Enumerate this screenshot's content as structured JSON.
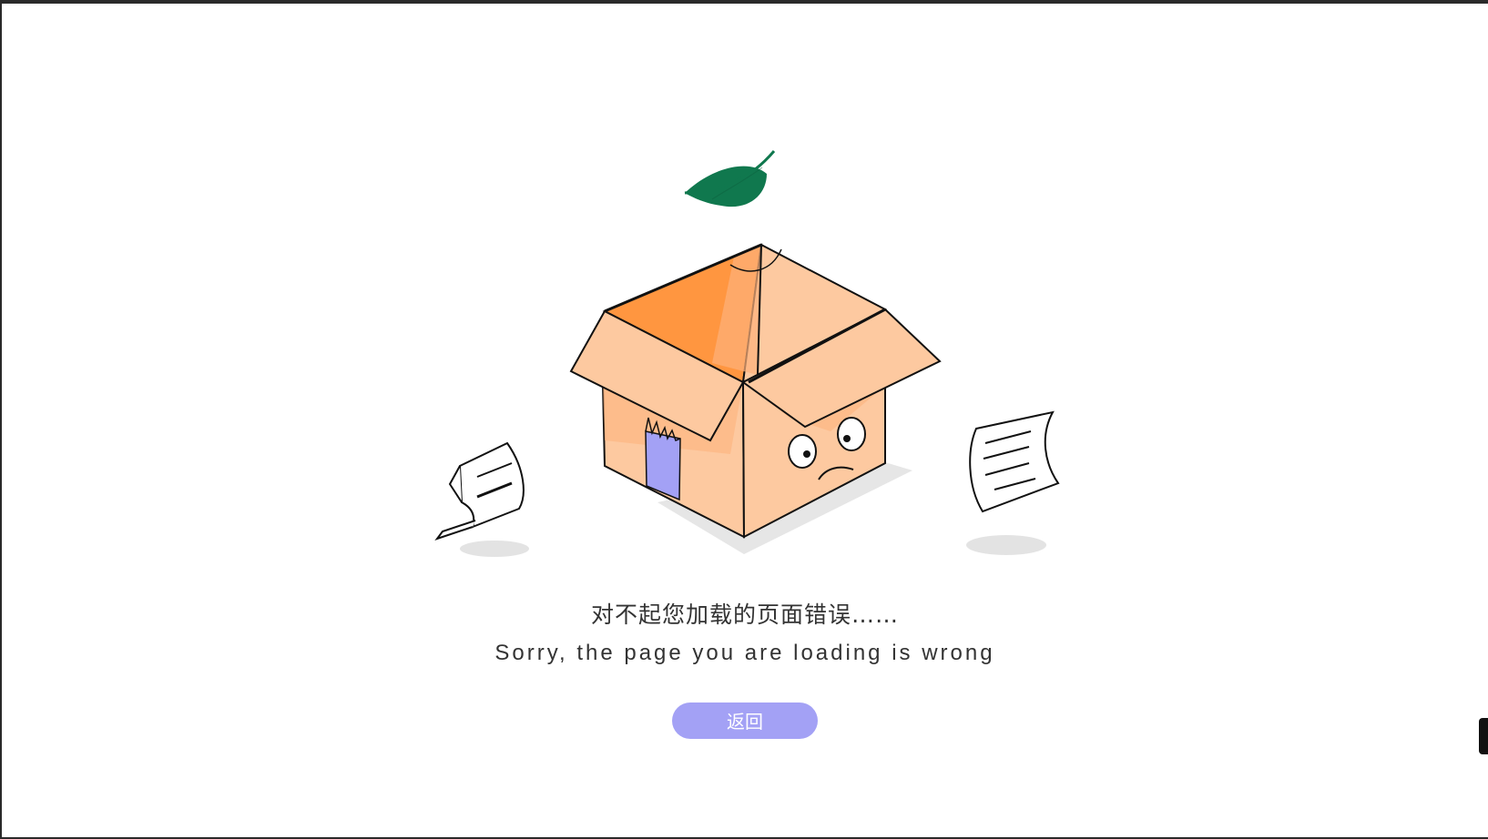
{
  "error": {
    "message_cn": "对不起您加载的页面错误……",
    "message_en": "Sorry, the page you are loading is wrong",
    "back_button_label": "返回"
  },
  "colors": {
    "accent_button": "#a3a1f5",
    "box_light": "#fdc9a0",
    "box_dark": "#ff9640",
    "leaf": "#10784e",
    "tape": "#a3a1f5"
  },
  "icons": {
    "illustration": "empty-box-illustration",
    "leaf": "leaf-icon",
    "paper": "paper-icon"
  }
}
